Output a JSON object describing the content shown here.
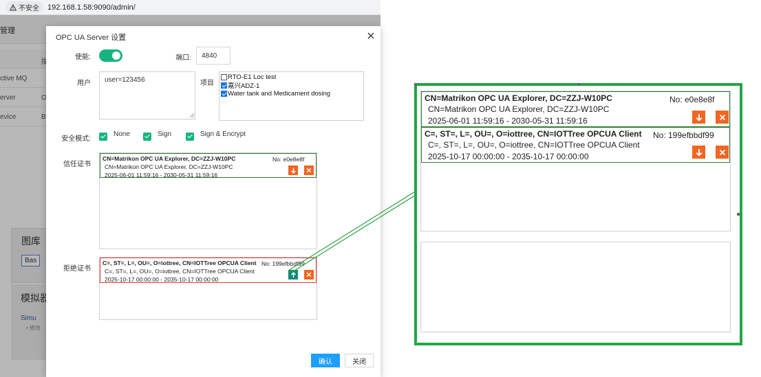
{
  "browser": {
    "security_label": "不安全",
    "url": "192.168.1.58:9090/admin/"
  },
  "background": {
    "header_title": "管理",
    "table_header_col2": "描",
    "rows": [
      {
        "name": "ctive MQ",
        "col2": ""
      },
      {
        "name": "erver",
        "col2": "O"
      },
      {
        "name": "evice",
        "col2": "B"
      }
    ],
    "gallery_title": "图库",
    "gallery_button": "Bas",
    "simulator_title": "模拟器",
    "simulator_link": "Simu",
    "simulator_sub": "• 修改"
  },
  "dialog": {
    "title": "OPC UA Server 设置",
    "enable_label": "使能:",
    "enabled": true,
    "port_label": "端口:",
    "port_value": "4840",
    "user_label": "用户",
    "user_value": "user=123456",
    "project_label": "项目",
    "projects": [
      {
        "label": "RTO-E1 Loc test",
        "checked": false
      },
      {
        "label": "嘉兴ADZ-1",
        "checked": true
      },
      {
        "label": "Water tank and Medicament dosing",
        "checked": true
      }
    ],
    "security_label": "安全模式:",
    "security_modes": [
      {
        "label": "None",
        "checked": true
      },
      {
        "label": "Sign",
        "checked": true
      },
      {
        "label": "Sign & Encrypt",
        "checked": true
      }
    ],
    "trusted_label": "信任证书",
    "rejected_label": "拒绝证书",
    "confirm_label": "确认",
    "close_label": "关闭"
  },
  "certs": {
    "trusted": [
      {
        "cn": "CN=Matrikon OPC UA Explorer, DC=ZZJ-W10PC",
        "no": "No: e0e8e8f",
        "subject": "CN=Matrikon OPC UA Explorer, DC=ZZJ-W10PC",
        "dates": "2025-06-01 11:59:16 - 2030-05-31 11:59:16"
      }
    ],
    "rejected": [
      {
        "cn": "C=, ST=, L=, OU=, O=iottree, CN=IOTTree OPCUA Client",
        "no": "No: 199efbbdf99",
        "subject": "C=, ST=, L=, OU=, O=iottree, CN=IOTTree OPCUA Client",
        "dates": "2025-10-17 00:00:00 - 2035-10-17 00:00:00"
      }
    ],
    "zoom_second": {
      "cn": "C=, ST=, L=, OU=, O=iottree, CN=IOTTree OPCUA Client",
      "no": "No: 199efbbdf99",
      "subject": "C=, ST=, L=, OU=, O=iottree, CN=IOTTree OPCUA Client",
      "dates": "2025-10-17 00:00:00 - 2035-10-17 00:00:00"
    }
  },
  "colors": {
    "accent_green": "#16b57f",
    "trusted_border": "#2e7d32",
    "rejected_border": "#e53935",
    "action_orange": "#f26522",
    "action_teal": "#138a7a",
    "highlight_green": "#22a745",
    "confirm_blue": "#1e9fff"
  },
  "icons": {
    "down": "arrow-down-icon",
    "up": "arrow-up-icon",
    "delete": "close-icon",
    "warning": "warning-icon"
  }
}
